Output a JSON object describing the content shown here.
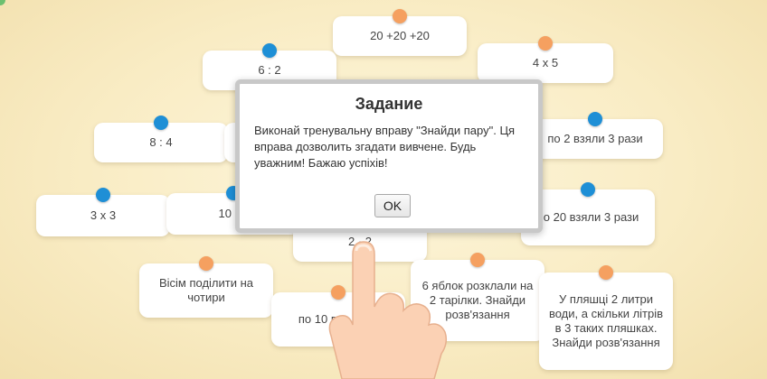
{
  "colors": {
    "pin_blue": "#1e8fd6",
    "pin_orange": "#f5a060",
    "background": "#f9ecc4"
  },
  "cards": [
    {
      "id": "c1",
      "pin": "orange",
      "text": "20 +20 +20"
    },
    {
      "id": "c2",
      "pin": "blue",
      "text": "6 : 2"
    },
    {
      "id": "c3",
      "pin": "orange",
      "text": "4 x 5"
    },
    {
      "id": "c4",
      "pin": "blue",
      "text": "8 : 4"
    },
    {
      "id": "c5",
      "pin": "none",
      "text": ""
    },
    {
      "id": "c6",
      "pin": "blue",
      "text": "по 2 взяли 3 рази"
    },
    {
      "id": "c7",
      "pin": "blue",
      "text": "3 x 3"
    },
    {
      "id": "c8",
      "pin": "blue",
      "text": "10 +1"
    },
    {
      "id": "c9",
      "pin": "blue",
      "text": "по 20 взяли 3 рази"
    },
    {
      "id": "c10",
      "pin": "none",
      "text": "2 · 2"
    },
    {
      "id": "c11",
      "pin": "orange",
      "text": "Вісім поділити на чотири"
    },
    {
      "id": "c12",
      "pin": "orange",
      "text": "6 яблок розклали на 2 тарілки. Знайди розв'язання"
    },
    {
      "id": "c13",
      "pin": "orange",
      "text": "по 10 взя... р..."
    },
    {
      "id": "c14",
      "pin": "orange",
      "text": "У пляшці 2 литри води, а скільки літрів в 3 таких пляшках. Знайди розв'язання"
    }
  ],
  "modal": {
    "title": "Задание",
    "text": "Виконай тренувальну вправу \"Знайди пару\". Ця вправа дозволить згадати вивчене. Будь уважним! Бажаю успіхів!",
    "ok_label": "OK"
  }
}
